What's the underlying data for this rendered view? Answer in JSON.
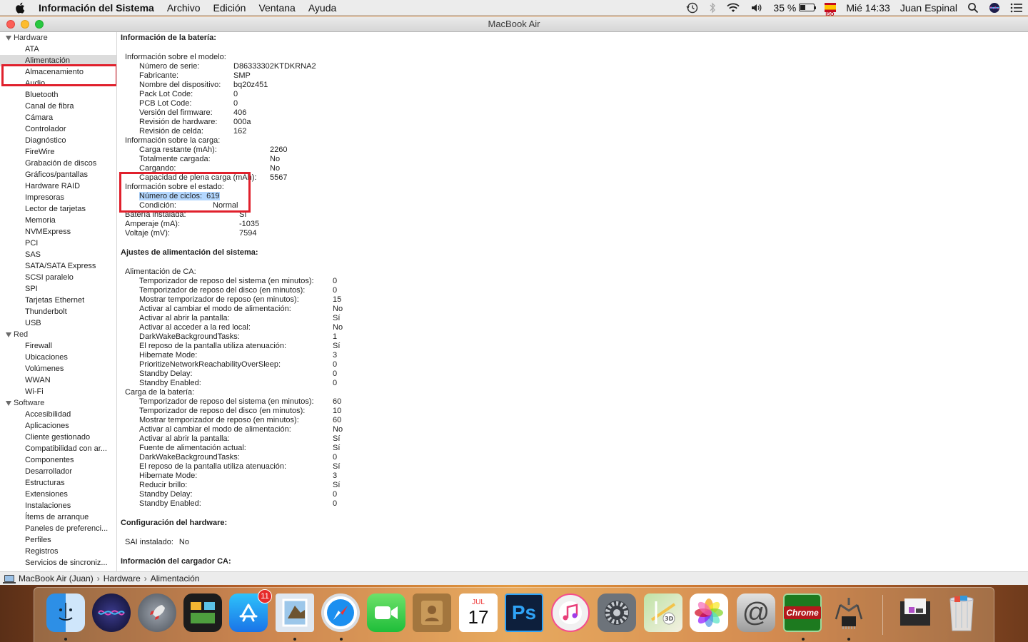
{
  "menubar": {
    "app": "Información del Sistema",
    "menus": [
      "Archivo",
      "Edición",
      "Ventana",
      "Ayuda"
    ],
    "battery_percent": "35 %",
    "battery_level": 0.35,
    "clock": "Mié 14:33",
    "user": "Juan Espinal"
  },
  "window": {
    "title": "MacBook Air"
  },
  "sidebar": {
    "sections": [
      {
        "label": "Hardware",
        "items": [
          "ATA",
          "Alimentación",
          "Almacenamiento",
          "Audio",
          "Bluetooth",
          "Canal de fibra",
          "Cámara",
          "Controlador",
          "Diagnóstico",
          "FireWire",
          "Grabación de discos",
          "Gráficos/pantallas",
          "Hardware RAID",
          "Impresoras",
          "Lector de tarjetas",
          "Memoria",
          "NVMExpress",
          "PCI",
          "SAS",
          "SATA/SATA Express",
          "SCSI paralelo",
          "SPI",
          "Tarjetas Ethernet",
          "Thunderbolt",
          "USB"
        ]
      },
      {
        "label": "Red",
        "items": [
          "Firewall",
          "Ubicaciones",
          "Volúmenes",
          "WWAN",
          "Wi-Fi"
        ]
      },
      {
        "label": "Software",
        "items": [
          "Accesibilidad",
          "Aplicaciones",
          "Cliente gestionado",
          "Compatibilidad con ar...",
          "Componentes",
          "Desarrollador",
          "Estructuras",
          "Extensiones",
          "Instalaciones",
          "Ítems de arranque",
          "Paneles de preferenci...",
          "Perfiles",
          "Registros",
          "Servicios de sincroniz..."
        ]
      }
    ],
    "selected": "Alimentación"
  },
  "battery": {
    "title": "Información de la batería:",
    "model_header": "Información sobre el modelo:",
    "model": [
      [
        "Número de serie:",
        "D86333302KTDKRNA2"
      ],
      [
        "Fabricante:",
        "SMP"
      ],
      [
        "Nombre del dispositivo:",
        "bq20z451"
      ],
      [
        "Pack Lot Code:",
        "0"
      ],
      [
        "PCB Lot Code:",
        "0"
      ],
      [
        "Versión del firmware:",
        "406"
      ],
      [
        "Revisión de hardware:",
        "000a"
      ],
      [
        "Revisión de celda:",
        "162"
      ]
    ],
    "charge_header": "Información sobre la carga:",
    "charge": [
      [
        "Carga restante (mAh):",
        "2260"
      ],
      [
        "Totalmente cargada:",
        "No"
      ],
      [
        "Cargando:",
        "No"
      ],
      [
        "Capacidad de plena carga (mAh):",
        "5567"
      ]
    ],
    "health_header": "Información sobre el estado:",
    "cycles_label": "Número de ciclos:",
    "cycles_value": "619",
    "condition_label": "Condición:",
    "condition_value": "Normal",
    "misc": [
      [
        "Batería instalada:",
        "Sí"
      ],
      [
        "Amperaje (mA):",
        "-1035"
      ],
      [
        "Voltaje (mV):",
        "7594"
      ]
    ]
  },
  "power": {
    "title": "Ajustes de alimentación del sistema:",
    "ac_header": "Alimentación de CA:",
    "ac": [
      [
        "Temporizador de reposo del sistema (en minutos):",
        "0"
      ],
      [
        "Temporizador de reposo del disco (en minutos):",
        "0"
      ],
      [
        "Mostrar temporizador de reposo (en minutos):",
        "15"
      ],
      [
        "Activar al cambiar el modo de alimentación:",
        "No"
      ],
      [
        "Activar al abrir la pantalla:",
        "Sí"
      ],
      [
        "Activar al acceder a la red local:",
        "No"
      ],
      [
        "DarkWakeBackgroundTasks:",
        "1"
      ],
      [
        "El reposo de la pantalla utiliza atenuación:",
        "Sí"
      ],
      [
        "Hibernate Mode:",
        "3"
      ],
      [
        "PrioritizeNetworkReachabilityOverSleep:",
        "0"
      ],
      [
        "Standby Delay:",
        "0"
      ],
      [
        "Standby Enabled:",
        "0"
      ]
    ],
    "bat_header": "Carga de la batería:",
    "bat": [
      [
        "Temporizador de reposo del sistema (en minutos):",
        "60"
      ],
      [
        "Temporizador de reposo del disco (en minutos):",
        "10"
      ],
      [
        "Mostrar temporizador de reposo (en minutos):",
        "60"
      ],
      [
        "Activar al cambiar el modo de alimentación:",
        "No"
      ],
      [
        "Activar al abrir la pantalla:",
        "Sí"
      ],
      [
        "Fuente de alimentación actual:",
        "Sí"
      ],
      [
        "DarkWakeBackgroundTasks:",
        "0"
      ],
      [
        "El reposo de la pantalla utiliza atenuación:",
        "Sí"
      ],
      [
        "Hibernate Mode:",
        "3"
      ],
      [
        "Reducir brillo:",
        "Sí"
      ],
      [
        "Standby Delay:",
        "0"
      ],
      [
        "Standby Enabled:",
        "0"
      ]
    ]
  },
  "hardware_config": {
    "title": "Configuración del hardware:",
    "sai_label": "SAI instalado:",
    "sai_value": "No"
  },
  "charger": {
    "title": "Información del cargador CA:"
  },
  "pathbar": {
    "crumbs": [
      "MacBook Air (Juan)",
      "Hardware",
      "Alimentación"
    ]
  },
  "dock": {
    "appstore_badge": "11",
    "calendar_month": "JUL",
    "calendar_day": "17",
    "photoshop_label": "Ps",
    "chrome_label": "Chrome",
    "mail_label": "@",
    "apps": [
      "finder",
      "siri",
      "launchpad",
      "mission-control",
      "app-store",
      "preview",
      "safari",
      "facetime",
      "contacts",
      "calendar",
      "photoshop",
      "itunes",
      "system-preferences",
      "maps",
      "photos",
      "mail",
      "chrome",
      "system-information",
      "downloads",
      "trash"
    ]
  }
}
